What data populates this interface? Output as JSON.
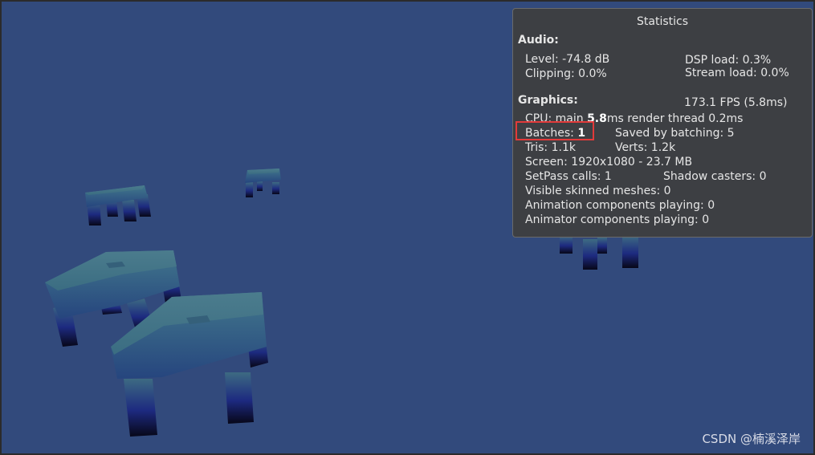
{
  "stats": {
    "title": "Statistics",
    "audio_header": "Audio:",
    "level": "Level: -74.8 dB",
    "dsp_load": "DSP load: 0.3%",
    "clipping": "Clipping: 0.0%",
    "stream_load": "Stream load: 0.0%",
    "graphics_header": "Graphics:",
    "fps": "173.1 FPS (5.8ms)",
    "cpu_prefix": "CPU: main ",
    "cpu_main": "5.8",
    "cpu_suffix": "ms  render thread 0.2ms",
    "batches_label": "Batches: ",
    "batches_value": "1",
    "saved_by_batching": "Saved by batching: 5",
    "tris": "Tris: 1.1k",
    "verts": "Verts: 1.2k",
    "screen": "Screen: 1920x1080 - 23.7 MB",
    "setpass": "SetPass calls: 1",
    "shadow_casters": "Shadow casters: 0",
    "skinned_meshes": "Visible skinned meshes: 0",
    "animation_components": "Animation components playing: 0",
    "animator_components": "Animator components playing: 0"
  },
  "watermark": "CSDN @楠溪泽岸",
  "colors": {
    "viewport_bg": "#324a7c",
    "table_top": "#3f6b80",
    "highlight": "#e23a3a"
  }
}
